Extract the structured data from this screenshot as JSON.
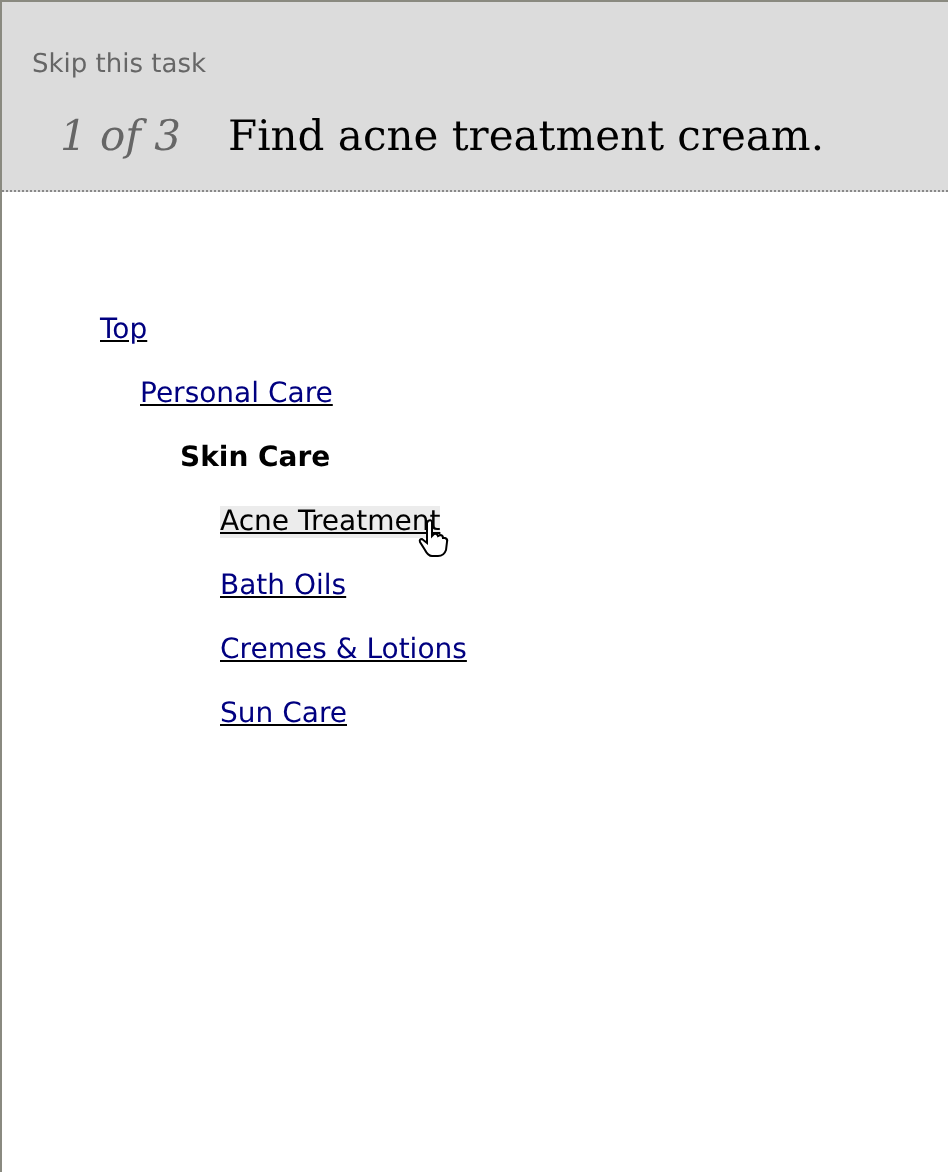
{
  "header": {
    "skip_link": "Skip this task",
    "counter": "1 of 3",
    "task": "Find acne treatment cream."
  },
  "tree": [
    {
      "label": "Top",
      "kind": "link",
      "hovered": false,
      "children": [
        {
          "label": "Personal Care",
          "kind": "link",
          "hovered": false,
          "children": [
            {
              "label": "Skin Care",
              "kind": "current",
              "children": [
                {
                  "label": "Acne Treatment",
                  "kind": "link",
                  "hovered": true
                },
                {
                  "label": "Bath Oils",
                  "kind": "link",
                  "hovered": false
                },
                {
                  "label": "Cremes & Lotions",
                  "kind": "link",
                  "hovered": false
                },
                {
                  "label": "Sun Care",
                  "kind": "link",
                  "hovered": false
                }
              ]
            }
          ]
        }
      ]
    }
  ]
}
